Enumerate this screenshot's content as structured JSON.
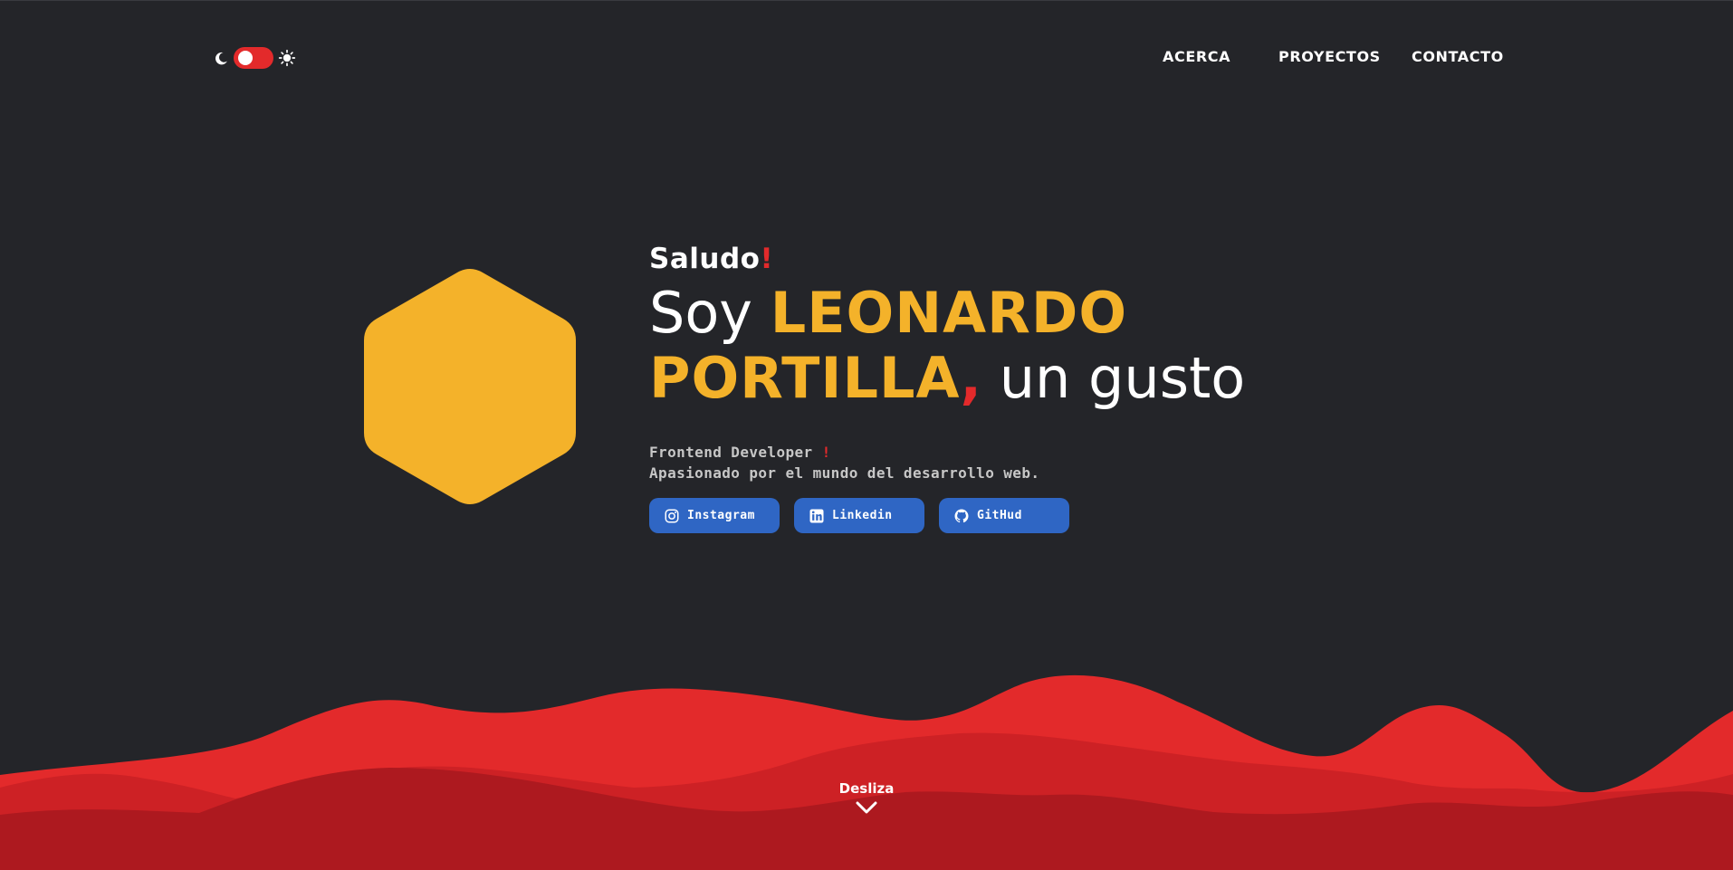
{
  "header": {
    "theme_toggle": {
      "left_icon": "moon-icon",
      "right_icon": "sun-icon",
      "state": "dark"
    },
    "nav": [
      {
        "label": "ACERCA"
      },
      {
        "label": "PROYECTOS"
      },
      {
        "label": "CONTACTO"
      }
    ]
  },
  "hero": {
    "greeting": "Saludo",
    "greeting_mark": "!",
    "headline_prefix": "Soy ",
    "name_line1": "LEONARDO",
    "name_line2": "PORTILLA",
    "comma": ",",
    "headline_suffix": " un gusto",
    "role": "Frontend Developer",
    "role_mark": "!",
    "tagline": "Apasionado por el mundo del desarrollo web.",
    "socials": [
      {
        "label": "Instagram",
        "icon": "instagram-icon"
      },
      {
        "label": "Linkedin",
        "icon": "linkedin-icon"
      },
      {
        "label": "GitHud",
        "icon": "github-icon"
      }
    ]
  },
  "scroll": {
    "label": "Desliza",
    "icon": "chevron-down-icon"
  },
  "colors": {
    "background": "#242529",
    "accent_yellow": "#f4b22a",
    "accent_red": "#e32a2b",
    "button_blue": "#2f66c4",
    "wave_light": "#e32a2b",
    "wave_mid": "#cd2125",
    "wave_dark": "#ad191f"
  }
}
